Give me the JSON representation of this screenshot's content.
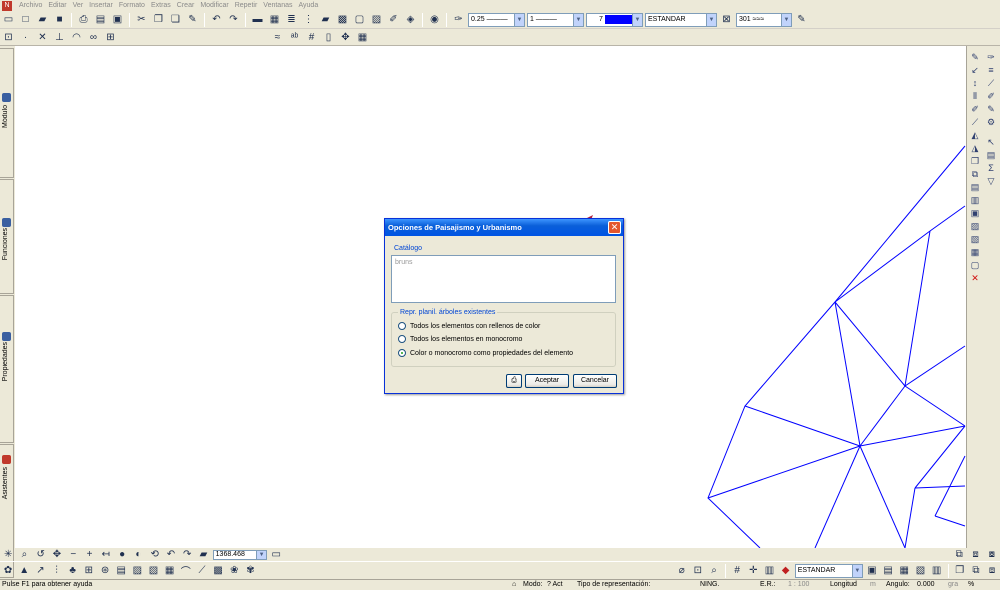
{
  "menu": {
    "items": [
      "Archivo",
      "Editar",
      "Ver",
      "Insertar",
      "Formato",
      "Extras",
      "Crear",
      "Modificar",
      "Repetir",
      "Ventanas",
      "Ayuda"
    ]
  },
  "toolbar": {
    "pen_thickness": "0.25",
    "line_type": "1",
    "color_index": "7",
    "layer": "ESTANDAR",
    "hatch": "301",
    "color_swatch": "#0000ff"
  },
  "left_tabs": [
    "Módulo",
    "Funciones",
    "Propiedades",
    "Asistentes"
  ],
  "nav": {
    "scale": "1368.468"
  },
  "bottom": {
    "layer": "ESTANDAR"
  },
  "status": {
    "help": "Pulse F1 para obtener ayuda",
    "modo_label": "Modo:",
    "modo_value": "? Act",
    "tipo_label": "Tipo de representación:",
    "ning": "NING.",
    "er_label": "E.R.:",
    "er_value": "1 : 100",
    "longitud": "Longitud",
    "unit1": "m",
    "angulo_label": "Angulo:",
    "angulo_value": "0.000",
    "unit2": "gra",
    "pct": "%"
  },
  "dialog": {
    "title": "Opciones de Paisajismo y Urbanismo",
    "catalog_label": "Catálogo",
    "catalog_value": "bruns",
    "group_label": "Repr. planil. árboles existentes",
    "options": [
      "Todos los elementos con rellenos de color",
      "Todos los elementos en monocromo",
      "Color o monocromo como propiedades del elemento"
    ],
    "selected": 2,
    "ok": "Aceptar",
    "cancel": "Cancelar"
  },
  "colors": {
    "accent": "#0054e3",
    "drawing": "#0000ff"
  }
}
